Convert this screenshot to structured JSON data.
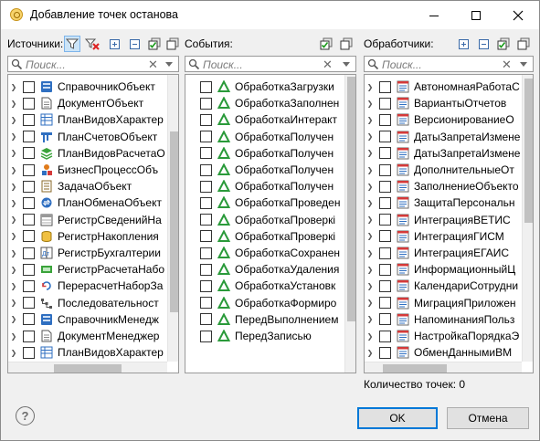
{
  "window": {
    "title": "Добавление точек останова",
    "controls": {
      "minimize": "minimize-icon",
      "maximize": "maximize-icon",
      "close": "close-icon"
    }
  },
  "sources": {
    "label": "Источники:",
    "search_placeholder": "Поиск...",
    "items": [
      {
        "label": "СправочникОбъект",
        "icon": "catalog-icon"
      },
      {
        "label": "ДокументОбъект",
        "icon": "document-icon"
      },
      {
        "label": "ПланВидовХарактер",
        "icon": "chart-of-characteristic-types-icon"
      },
      {
        "label": "ПланСчетовОбъект",
        "icon": "chart-of-accounts-icon"
      },
      {
        "label": "ПланВидовРасчетаО",
        "icon": "chart-of-calculation-types-icon"
      },
      {
        "label": "БизнесПроцессОбъ",
        "icon": "business-process-icon"
      },
      {
        "label": "ЗадачаОбъект",
        "icon": "task-icon"
      },
      {
        "label": "ПланОбменаОбъект",
        "icon": "exchange-plan-icon"
      },
      {
        "label": "РегистрСведенийНа",
        "icon": "information-register-icon"
      },
      {
        "label": "РегистрНакопления",
        "icon": "accumulation-register-icon"
      },
      {
        "label": "РегистрБухгалтерии",
        "icon": "accounting-register-icon"
      },
      {
        "label": "РегистрРасчетаНабо",
        "icon": "calculation-register-icon"
      },
      {
        "label": "ПерерасчетНаборЗа",
        "icon": "recalculation-icon"
      },
      {
        "label": "Последовательност",
        "icon": "sequence-icon"
      },
      {
        "label": "СправочникМенедж",
        "icon": "catalog-icon"
      },
      {
        "label": "ДокументМенеджер",
        "icon": "document-icon"
      },
      {
        "label": "ПланВидовХарактер",
        "icon": "chart-of-characteristic-types-icon"
      }
    ]
  },
  "events": {
    "label": "События:",
    "search_placeholder": "Поиск...",
    "items": [
      "ОбработкаЗагрузки",
      "ОбработкаЗаполнен",
      "ОбработкаИнтеракт",
      "ОбработкаПолучен",
      "ОбработкаПолучен",
      "ОбработкаПолучен",
      "ОбработкаПолучен",
      "ОбработкаПроведен",
      "ОбработкаПроверкі",
      "ОбработкаПроверкі",
      "ОбработкаСохранен",
      "ОбработкаУдаления",
      "ОбработкаУстановк",
      "ОбработкаФормиро",
      "ПередВыполнением",
      "ПередЗаписью"
    ]
  },
  "handlers": {
    "label": "Обработчики:",
    "search_placeholder": "Поиск...",
    "items": [
      "АвтономнаяРаботаС",
      "ВариантыОтчетов",
      "ВерсионированиеО",
      "ДатыЗапретаИзмене",
      "ДатыЗапретаИзмене",
      "ДополнительныеОт",
      "ЗаполнениеОбъекто",
      "ЗащитаПерсональн",
      "ИнтеграцияВЕТИС",
      "ИнтеграцияГИСМ",
      "ИнтеграцияЕГАИС",
      "ИнформационныйЦ",
      "КалендариСотрудни",
      "МиграцияПриложен",
      "НапоминанияПольз",
      "НастройкаПорядкаЭ",
      "ОбменДаннымиВМ"
    ]
  },
  "status": {
    "count_text": "Количество точек: 0"
  },
  "buttons": {
    "ok": "OK",
    "cancel": "Отмена",
    "help": "?"
  },
  "colors": {
    "accent": "#0078d7",
    "event_icon": "#2a9a3a",
    "catalog_blue": "#2f6fc1"
  }
}
